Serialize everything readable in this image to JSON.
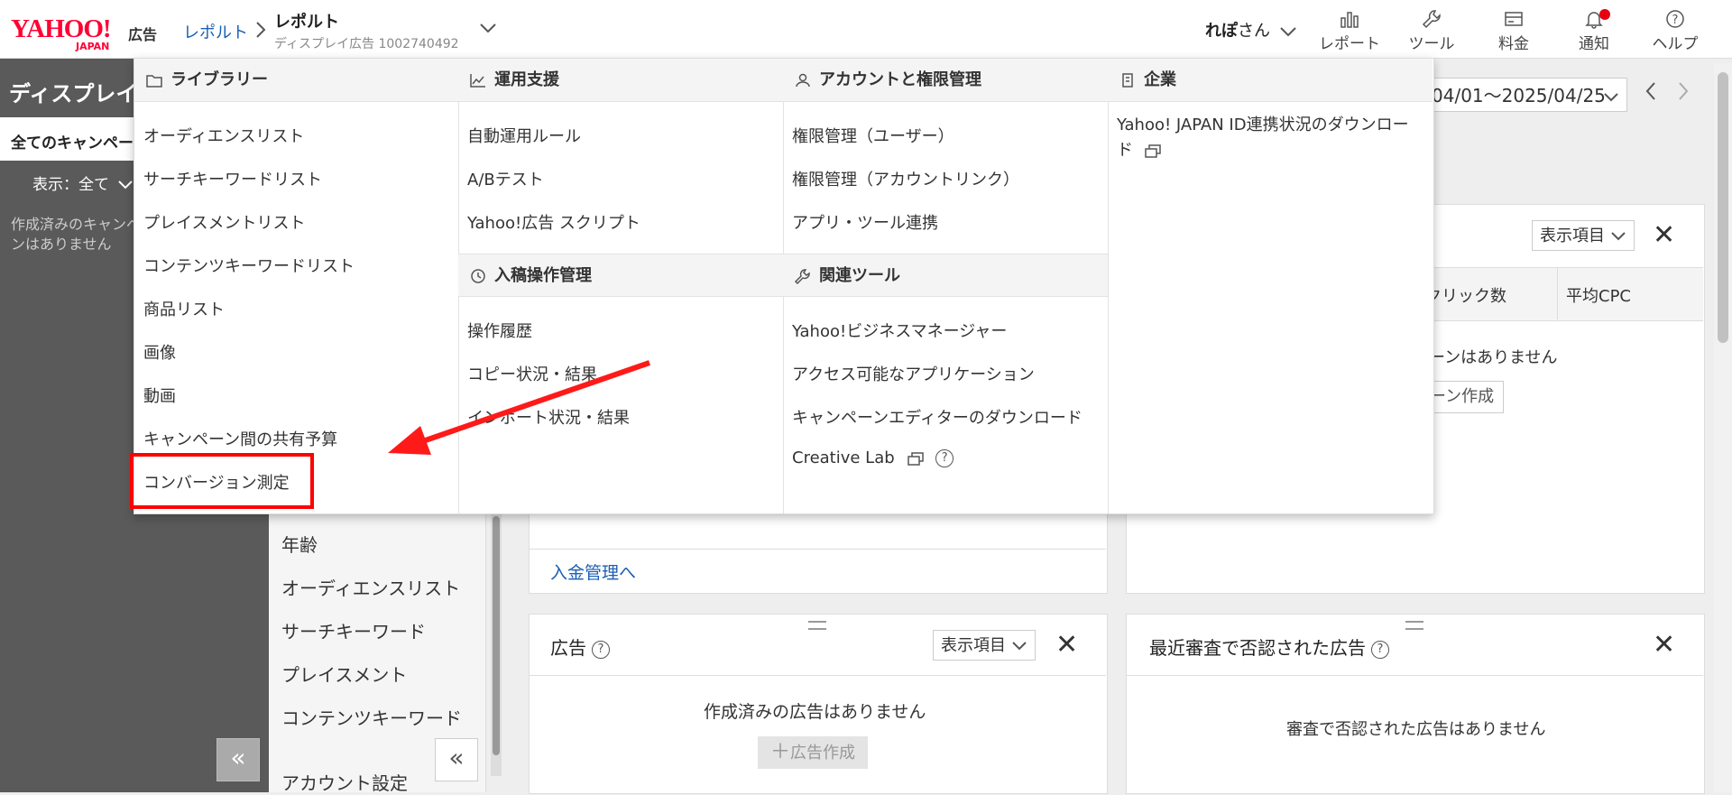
{
  "header": {
    "logo_text": "YAHOO!",
    "logo_sub": "JAPAN",
    "logo_ad": "広告",
    "breadcrumb_link": "レポルト",
    "account_name": "レポルト",
    "account_sub": "ディスプレイ広告 1002740492",
    "user_name": "れぽ",
    "user_suffix": "さん",
    "tools": [
      {
        "label": "レポート",
        "icon": "bar-chart-icon"
      },
      {
        "label": "ツール",
        "icon": "wrench-icon"
      },
      {
        "label": "料金",
        "icon": "billing-icon"
      },
      {
        "label": "通知",
        "icon": "bell-icon"
      },
      {
        "label": "ヘルプ",
        "icon": "help-icon"
      }
    ]
  },
  "sidebar": {
    "title": "ディスプレイ",
    "all_campaigns": "全てのキャンペー",
    "filter": "表示：全て",
    "empty": "作成済みのキャンペーンはありません"
  },
  "subnav": {
    "items": [
      "年齢",
      "オーディエンスリスト",
      "サーチキーワード",
      "プレイスメント",
      "コンテンツキーワード",
      "アカウント設定"
    ]
  },
  "date_range": "04/01〜2025/04/25",
  "panels": {
    "campaign": {
      "display_items": "表示項目",
      "col_clicks": "クリック数",
      "col_cpc": "平均CPC",
      "empty": "ーンはありません",
      "create": "ーン作成"
    },
    "billing_link": "入金管理へ",
    "ads": {
      "title": "広告",
      "display_items": "表示項目",
      "empty": "作成済みの広告はありません",
      "create": "広告作成"
    },
    "rejected": {
      "title": "最近審査で否認された広告",
      "empty": "審査で否認された広告はありません"
    }
  },
  "mega_menu": {
    "columns": [
      {
        "sections": [
          {
            "title": "ライブラリー",
            "icon": "folder-icon",
            "items": [
              "オーディエンスリスト",
              "サーチキーワードリスト",
              "プレイスメントリスト",
              "コンテンツキーワードリスト",
              "商品リスト",
              "画像",
              "動画",
              "キャンペーン間の共有予算",
              "コンバージョン測定"
            ]
          }
        ]
      },
      {
        "sections": [
          {
            "title": "運用支援",
            "icon": "line-chart-icon",
            "items": [
              "自動運用ルール",
              "A/Bテスト",
              "Yahoo!広告 スクリプト"
            ]
          },
          {
            "title": "入稿操作管理",
            "icon": "history-icon",
            "items": [
              "操作履歴",
              "コピー状況・結果",
              "インポート状況・結果"
            ]
          }
        ]
      },
      {
        "sections": [
          {
            "title": "アカウントと権限管理",
            "icon": "person-icon",
            "items": [
              "権限管理（ユーザー）",
              "権限管理（アカウントリンク）",
              "アプリ・ツール連携"
            ]
          },
          {
            "title": "関連ツール",
            "icon": "wrench-icon",
            "items": [
              "Yahoo!ビジネスマネージャー",
              "アクセス可能なアプリケーション",
              "キャンペーンエディターのダウンロード",
              "Creative Lab"
            ]
          }
        ]
      },
      {
        "sections": [
          {
            "title": "企業",
            "icon": "building-icon",
            "items": [
              "Yahoo! JAPAN ID連携状況のダウンロード"
            ]
          }
        ]
      }
    ]
  },
  "colors": {
    "brand": "#ff0033",
    "link": "#1a5fb4",
    "highlight": "#ff0000",
    "sidebar": "#5a5a5a"
  }
}
